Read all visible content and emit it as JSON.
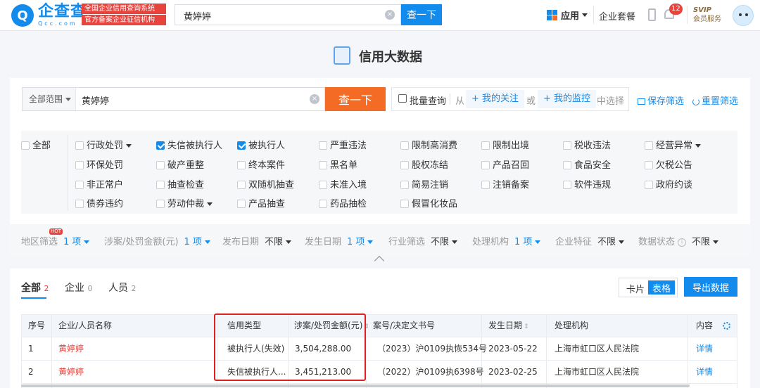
{
  "top": {
    "logo_mark": "Q",
    "logo_name": "企查查",
    "logo_domain": "Qcc.com",
    "badge_line1": "全国企业信用查询系统",
    "badge_line2": "官方备案企业征信机构",
    "search_value": "黄婷婷",
    "search_button": "查一下",
    "apps_label": "应用",
    "package_label": "企业套餐",
    "notification_count": "12",
    "svip_label": "SVIP",
    "svip_sub": "会员服务"
  },
  "page": {
    "title": "信用大数据"
  },
  "search": {
    "scope_label": "全部范围",
    "value": "黄婷婷",
    "button": "查一下",
    "batch_query": "批量查询",
    "from_label": "从",
    "my_follow": "+ 我的关注",
    "or_label": "或",
    "my_monitor": "+ 我的监控",
    "select_suffix": "中选择",
    "save_filter": "保存筛选",
    "reset_filter": "重置筛选"
  },
  "categories": {
    "all_label": "全部",
    "items": [
      {
        "label": "行政处罚",
        "checked": false,
        "dropdown": true
      },
      {
        "label": "失信被执行人",
        "checked": true,
        "dropdown": false
      },
      {
        "label": "被执行人",
        "checked": true,
        "dropdown": false
      },
      {
        "label": "严重违法",
        "checked": false,
        "dropdown": false
      },
      {
        "label": "限制高消费",
        "checked": false,
        "dropdown": false
      },
      {
        "label": "限制出境",
        "checked": false,
        "dropdown": false
      },
      {
        "label": "税收违法",
        "checked": false,
        "dropdown": false
      },
      {
        "label": "经营异常",
        "checked": false,
        "dropdown": true
      },
      {
        "label": "环保处罚",
        "checked": false,
        "dropdown": false
      },
      {
        "label": "破产重整",
        "checked": false,
        "dropdown": false
      },
      {
        "label": "终本案件",
        "checked": false,
        "dropdown": false
      },
      {
        "label": "黑名单",
        "checked": false,
        "dropdown": false
      },
      {
        "label": "股权冻结",
        "checked": false,
        "dropdown": false
      },
      {
        "label": "产品召回",
        "checked": false,
        "dropdown": false
      },
      {
        "label": "食品安全",
        "checked": false,
        "dropdown": false
      },
      {
        "label": "欠税公告",
        "checked": false,
        "dropdown": false
      },
      {
        "label": "非正常户",
        "checked": false,
        "dropdown": false
      },
      {
        "label": "抽查检查",
        "checked": false,
        "dropdown": false
      },
      {
        "label": "双随机抽查",
        "checked": false,
        "dropdown": false
      },
      {
        "label": "未准入境",
        "checked": false,
        "dropdown": false
      },
      {
        "label": "简易注销",
        "checked": false,
        "dropdown": false
      },
      {
        "label": "注销备案",
        "checked": false,
        "dropdown": false
      },
      {
        "label": "软件违规",
        "checked": false,
        "dropdown": false
      },
      {
        "label": "政府约谈",
        "checked": false,
        "dropdown": false
      },
      {
        "label": "债券违约",
        "checked": false,
        "dropdown": false
      },
      {
        "label": "劳动仲裁",
        "checked": false,
        "dropdown": true
      },
      {
        "label": "产品抽查",
        "checked": false,
        "dropdown": false
      },
      {
        "label": "药品抽检",
        "checked": false,
        "dropdown": false
      },
      {
        "label": "假冒化妆品",
        "checked": false,
        "dropdown": false
      }
    ]
  },
  "filters": [
    {
      "label": "地区筛选",
      "value": "1 项",
      "active": true,
      "hot": "HOT"
    },
    {
      "label": "涉案/处罚金额(元)",
      "value": "1 项",
      "active": true
    },
    {
      "label": "发布日期",
      "value": "不限",
      "active": false
    },
    {
      "label": "发生日期",
      "value": "1 项",
      "active": true
    },
    {
      "label": "行业筛选",
      "value": "不限",
      "active": false
    },
    {
      "label": "处理机构",
      "value": "1 项",
      "active": true
    },
    {
      "label": "企业特征",
      "value": "不限",
      "active": false
    },
    {
      "label": "数据状态",
      "value": "不限",
      "active": false
    }
  ],
  "results": {
    "tabs": [
      {
        "label": "全部",
        "count": "2"
      },
      {
        "label": "企业",
        "count": "0"
      },
      {
        "label": "人员",
        "count": "2"
      }
    ],
    "view_card": "卡片",
    "view_table": "表格",
    "export": "导出数据",
    "columns": [
      "序号",
      "企业/人员名称",
      "信用类型",
      "涉案/处罚金额(元)",
      "案号/决定文书号",
      "发生日期",
      "处理机构",
      "内容"
    ],
    "rows": [
      {
        "no": "1",
        "name": "黄婷婷",
        "type": "被执行人(失效)",
        "amount": "3,504,288.00",
        "case": "（2023）沪0109执恢534号",
        "date": "2023-05-22",
        "org": "上海市虹口区人民法院",
        "detail": "详情"
      },
      {
        "no": "2",
        "name": "黄婷婷",
        "type": "失信被执行人...",
        "amount": "3,451,213.00",
        "case": "（2022）沪0109执6398号",
        "date": "2023-02-25",
        "org": "上海市虹口区人民法院",
        "detail": "详情"
      }
    ]
  },
  "colors": {
    "accent": "#128bed",
    "search_button": "#f36b24",
    "highlight_box": "#e02020",
    "name_link": "#e8433d"
  }
}
